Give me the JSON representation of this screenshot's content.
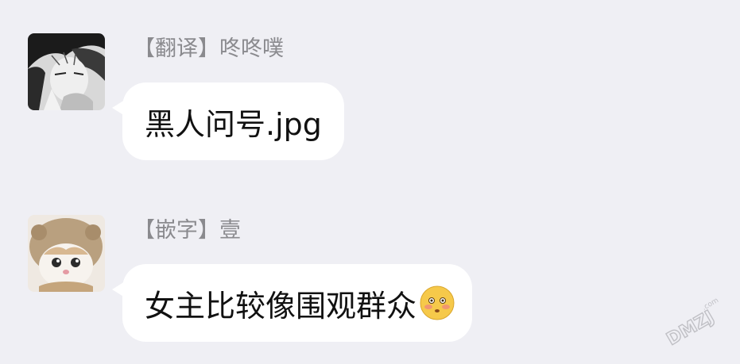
{
  "messages": [
    {
      "sender": "【翻译】咚咚噗",
      "text": "黑人问号.jpg",
      "emoji": ""
    },
    {
      "sender": "【嵌字】壹",
      "text": "女主比较像围观群众",
      "emoji": "flushed-face-emoji"
    }
  ],
  "watermark": {
    "text": "DMZJ.com"
  },
  "colors": {
    "background": "#efeff4",
    "bubble": "#ffffff",
    "sender_name": "#8a8a8e",
    "message_text": "#111111"
  }
}
